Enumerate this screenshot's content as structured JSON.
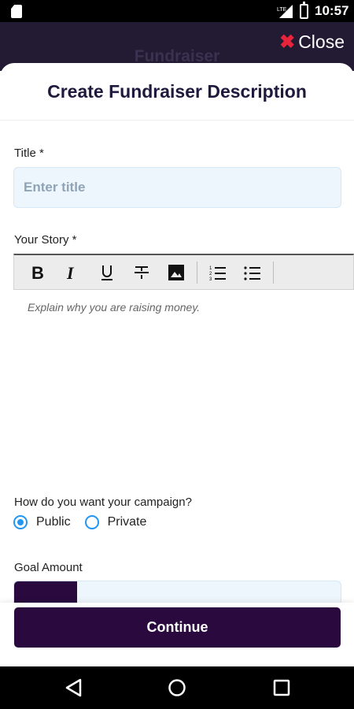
{
  "status_bar": {
    "time": "10:57",
    "network": "LTE"
  },
  "backdrop": {
    "title": "Fundraiser"
  },
  "close_button": {
    "label": "Close"
  },
  "sheet": {
    "title": "Create Fundraiser Description"
  },
  "title_field": {
    "label": "Title *",
    "placeholder": "Enter title",
    "value": ""
  },
  "story_field": {
    "label": "Your Story *",
    "placeholder": "Explain why you are raising money.",
    "toolbar": [
      "bold-icon",
      "italic-icon",
      "underline-icon",
      "strikethrough-icon",
      "image-icon",
      "ordered-list-icon",
      "bullet-list-icon"
    ]
  },
  "campaign": {
    "question": "How do you want your campaign?",
    "options": [
      {
        "label": "Public",
        "selected": true
      },
      {
        "label": "Private",
        "selected": false
      }
    ]
  },
  "goal_field": {
    "label": "Goal Amount"
  },
  "continue_button": {
    "label": "Continue"
  },
  "colors": {
    "accent": "#2a0a3e",
    "radio": "#2196f3",
    "close_icon": "#e8243a",
    "input_bg": "#eef6fd"
  }
}
